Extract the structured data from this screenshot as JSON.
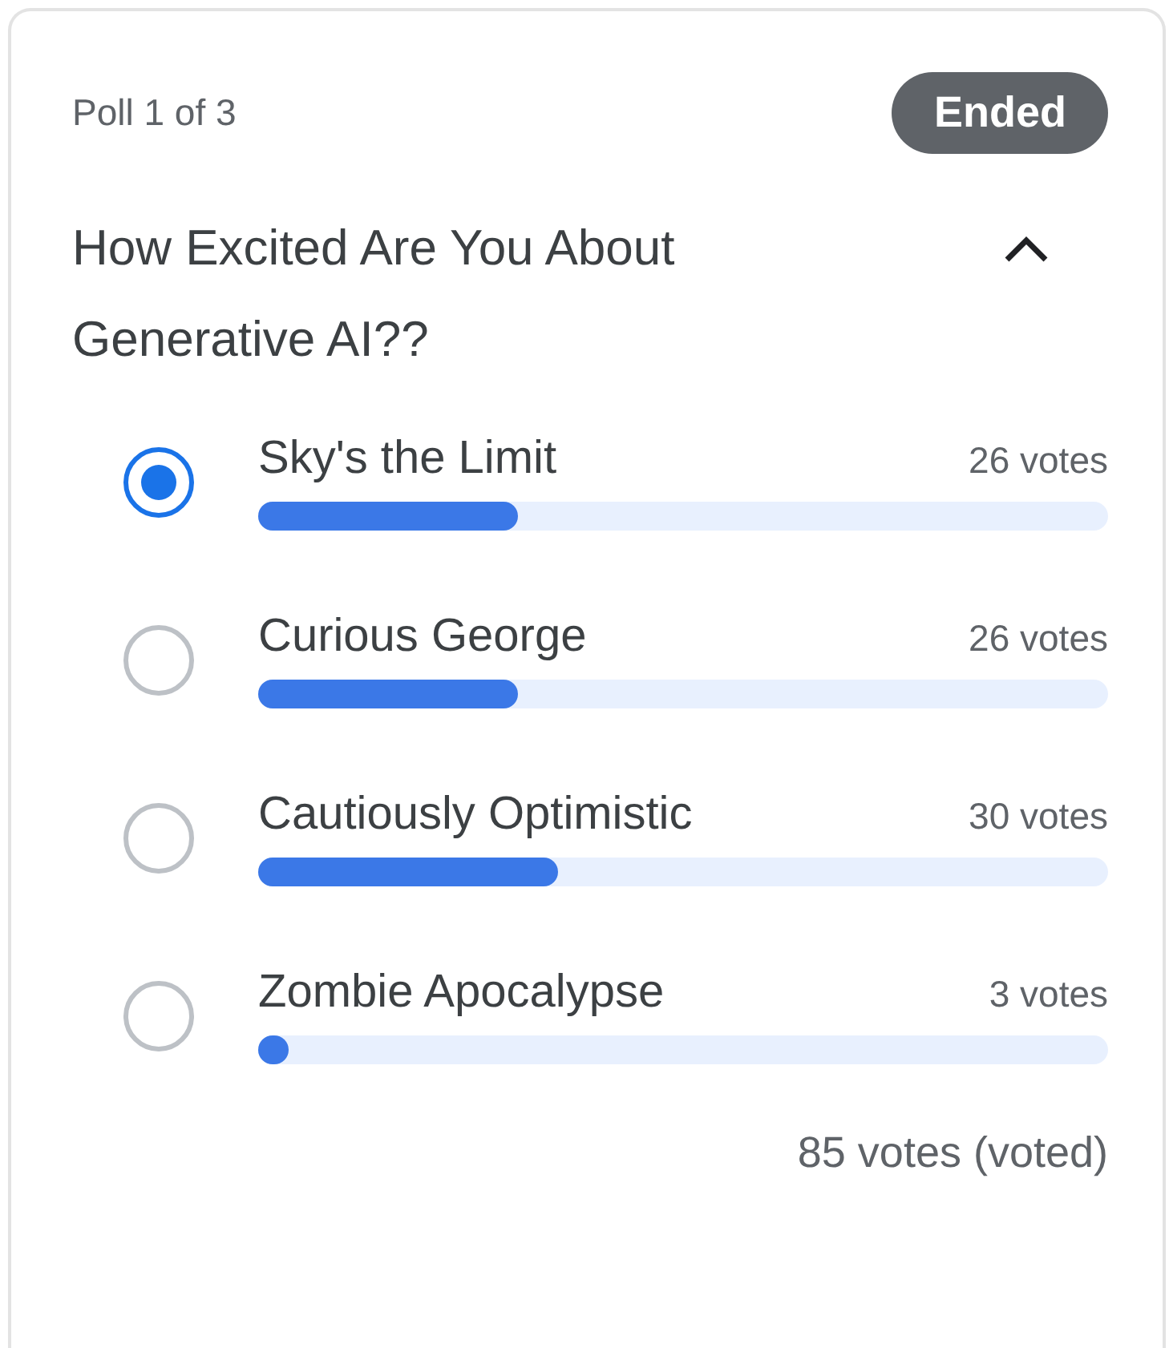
{
  "poll": {
    "counter": "Poll 1 of 3",
    "status": "Ended",
    "question": "How Excited Are You About Generative AI??",
    "expanded": true,
    "options": [
      {
        "label": "Sky's the Limit",
        "votes": "26 votes",
        "level": 0.306,
        "selected": true
      },
      {
        "label": "Curious George",
        "votes": "26 votes",
        "level": 0.306,
        "selected": false
      },
      {
        "label": "Cautiously Optimistic",
        "votes": "30 votes",
        "level": 0.353,
        "selected": false
      },
      {
        "label": "Zombie Apocalypse",
        "votes": "3 votes",
        "level": 0.035,
        "selected": false
      }
    ],
    "total": "85 votes (voted)"
  }
}
